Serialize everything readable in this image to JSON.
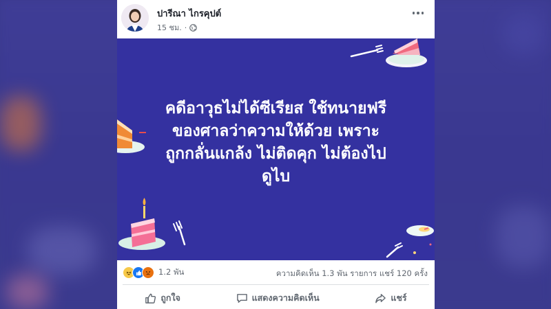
{
  "post": {
    "author": "ปารีณา ไกรคุปต์",
    "time": "15 ชม.",
    "separator": "·",
    "banner_lines": [
      "คดีอาวุธไม่ได้ซีเรียส ใช้ทนายฟรี",
      "ของศาลว่าความให้ด้วย เพราะ",
      "ถูกกลั่นแกล้ง ไม่ติดคุก ไม่ต้องไป",
      "ดูไบ"
    ],
    "banner_color": "#3431a0"
  },
  "stats": {
    "reaction_count": "1.2 พัน",
    "comments": "ความคิดเห็น 1.3 พัน รายการ",
    "shares": "แชร์ 120 ครั้ง"
  },
  "actions": {
    "like": "ถูกใจ",
    "comment": "แสดงความคิดเห็น",
    "share": "แชร์"
  }
}
